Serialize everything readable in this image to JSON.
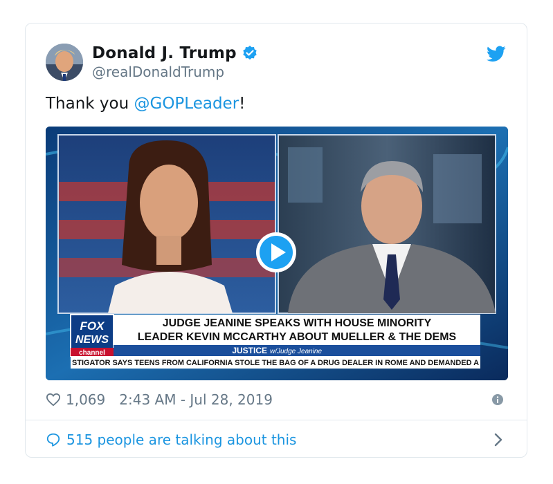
{
  "tweet": {
    "display_name": "Donald J. Trump",
    "handle": "@realDonaldTrump",
    "text_prefix": "Thank you ",
    "mention": "@GOPLeader",
    "text_suffix": "!",
    "likes": "1,069",
    "timestamp": "2:43 AM - Jul 28, 2019",
    "talking": "515 people are talking about this"
  },
  "media": {
    "chyron_line1": "JUDGE JEANINE SPEAKS WITH HOUSE MINORITY",
    "chyron_line2": "LEADER KEVIN MCCARTHY ABOUT MUELLER & THE DEMS",
    "logo_line1": "FOX",
    "logo_line2": "NEWS",
    "logo_line3": "channel",
    "show_name": "JUSTICE",
    "show_sub": "w/Judge Jeanine",
    "ticker": "STIGATOR SAYS TEENS FROM CALIFORNIA STOLE THE BAG OF A DRUG DEALER IN ROME AND DEMANDED A"
  },
  "colors": {
    "accent": "#1da1f2",
    "link": "#1b95e0",
    "muted": "#657786",
    "text": "#14171a"
  },
  "icons": {
    "verified": "verified-badge-icon",
    "brand": "twitter-bird-icon",
    "like": "heart-icon",
    "info": "info-icon",
    "reply": "speech-bubble-icon",
    "more": "chevron-right-icon",
    "play": "play-icon"
  }
}
